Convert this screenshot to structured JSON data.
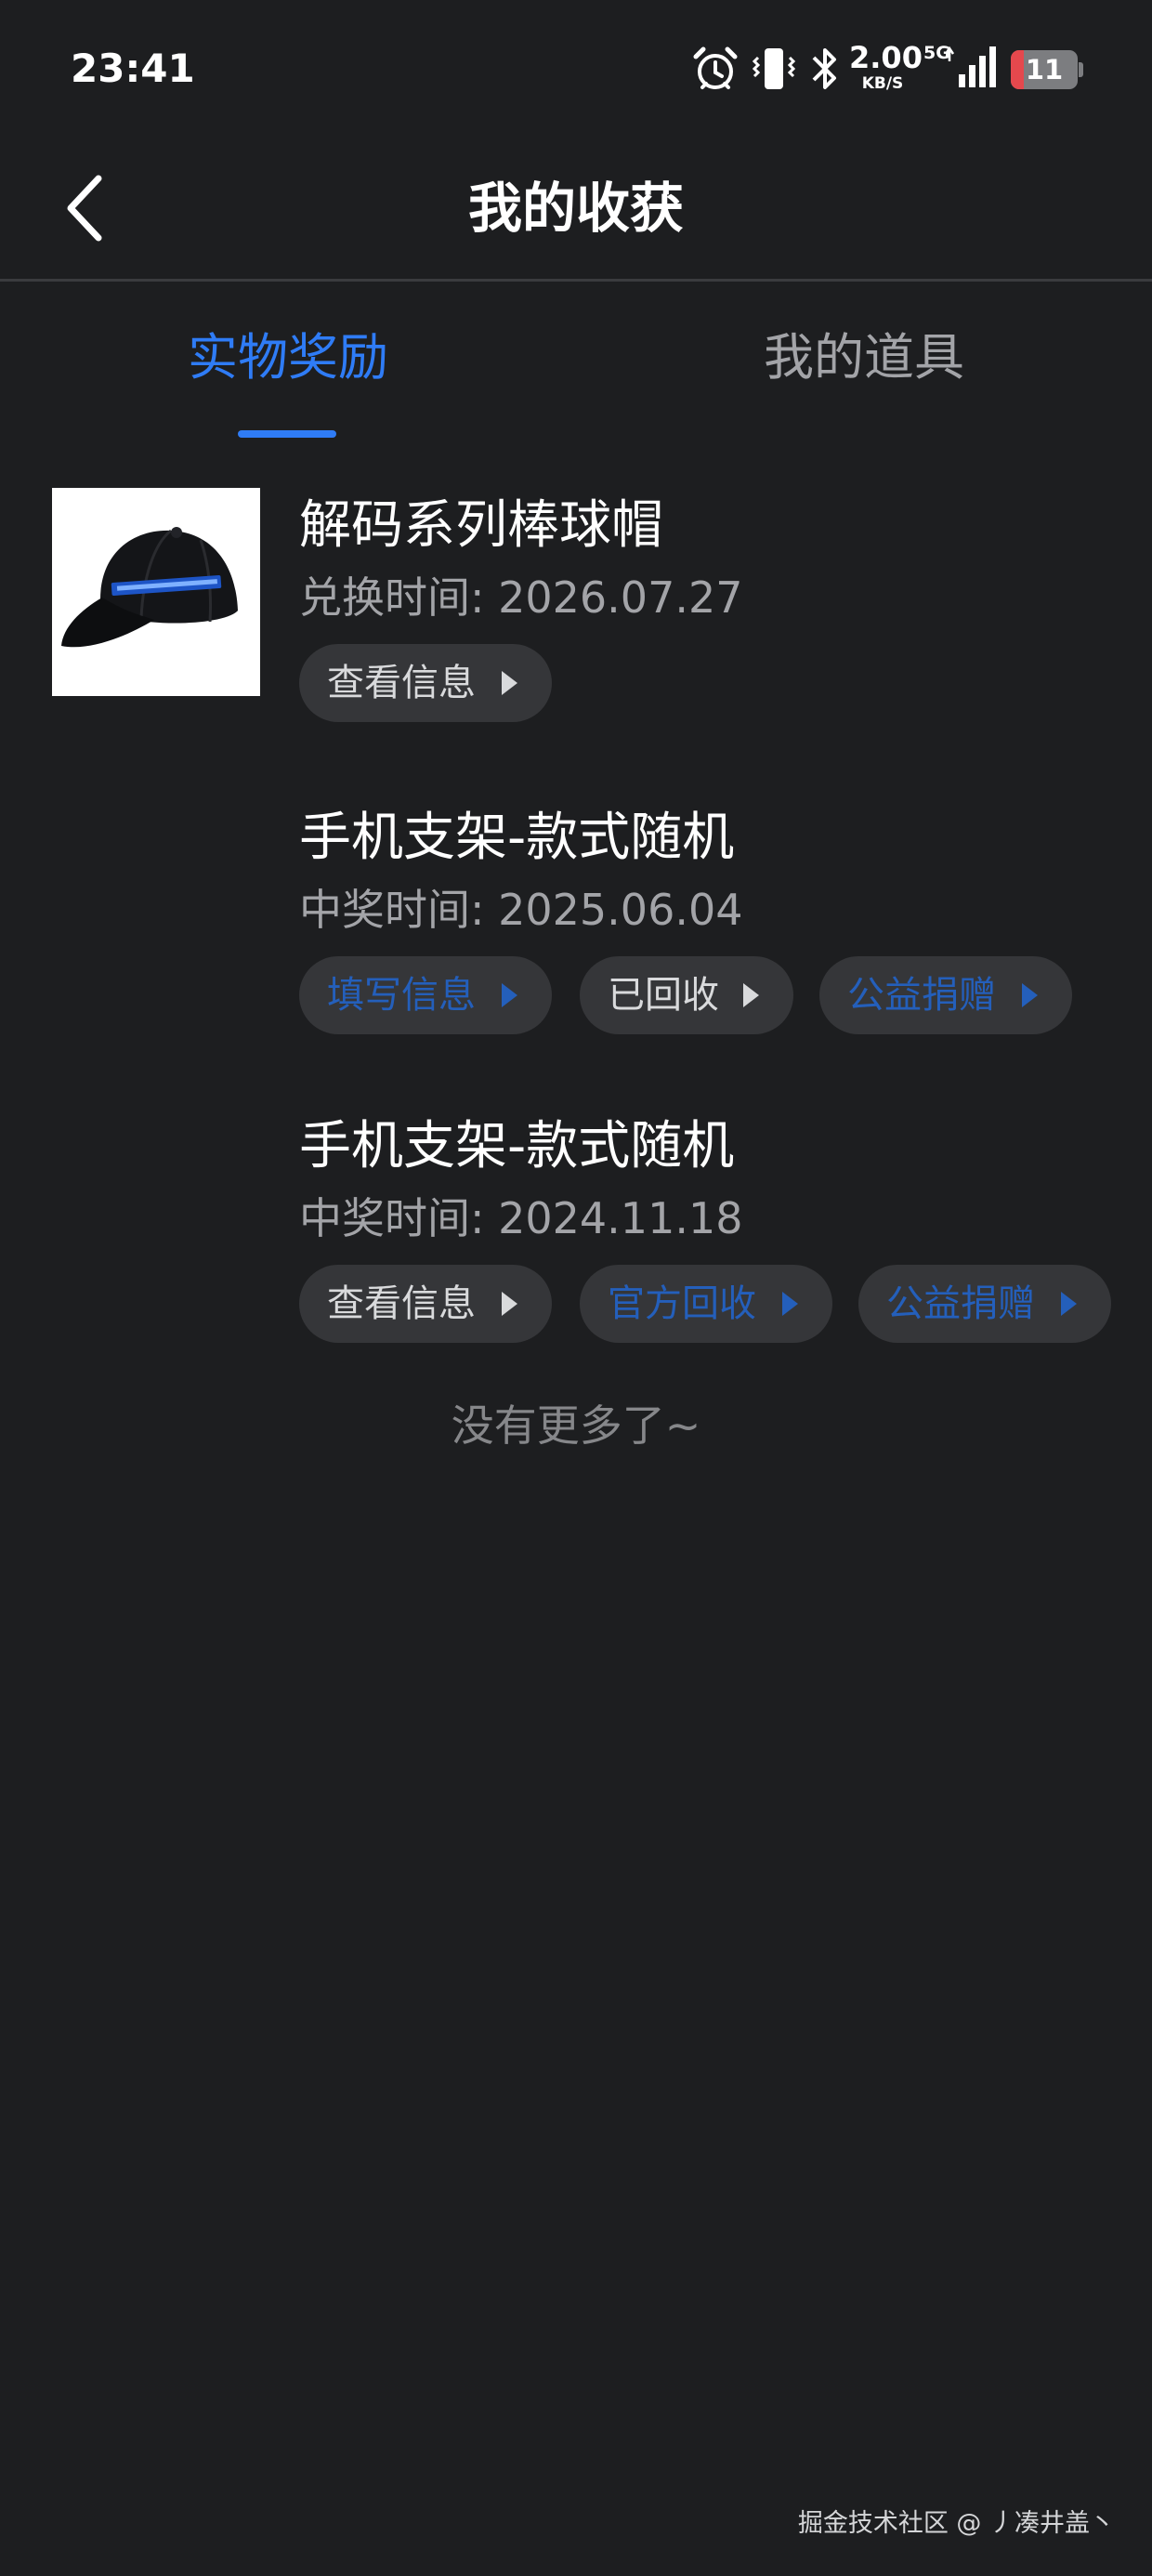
{
  "status_bar": {
    "time": "23:41",
    "net_speed_value": "2.00",
    "net_speed_unit": "KB/S",
    "network_type": "5G",
    "battery_level": "11",
    "battery_fraction": 0.11,
    "icons": [
      "alarm-icon",
      "vibrate-icon",
      "bluetooth-icon",
      "signal-icon",
      "battery-icon"
    ]
  },
  "header": {
    "title": "我的收获",
    "back_icon": "chevron-left-icon"
  },
  "tabs": [
    {
      "label": "实物奖励",
      "active": true
    },
    {
      "label": "我的道具",
      "active": false
    }
  ],
  "rewards": [
    {
      "name": "解码系列棒球帽",
      "time": "兑换时间: 2026.07.27",
      "has_image": true,
      "image_icon": "baseball-cap-image",
      "actions": [
        {
          "label": "查看信息",
          "style": "light"
        }
      ]
    },
    {
      "name": "手机支架-款式随机",
      "time": "中奖时间: 2025.06.04",
      "has_image": false,
      "actions": [
        {
          "label": "填写信息",
          "style": "blue"
        },
        {
          "label": "已回收",
          "style": "light"
        },
        {
          "label": "公益捐赠",
          "style": "blue"
        }
      ]
    },
    {
      "name": "手机支架-款式随机",
      "time": "中奖时间: 2024.11.18",
      "has_image": false,
      "actions": [
        {
          "label": "查看信息",
          "style": "light"
        },
        {
          "label": "官方回收",
          "style": "blue"
        },
        {
          "label": "公益捐赠",
          "style": "blue"
        }
      ]
    }
  ],
  "end_text": "没有更多了~",
  "watermark": "掘金技术社区 @ 丿凑井盖丶",
  "colors": {
    "background": "#1d1e20",
    "accent": "#2f7cf6",
    "pill": "#353639",
    "muted_text": "#a3a4a8",
    "blue_action": "#245fbb",
    "battery_low": "#e5484d"
  }
}
